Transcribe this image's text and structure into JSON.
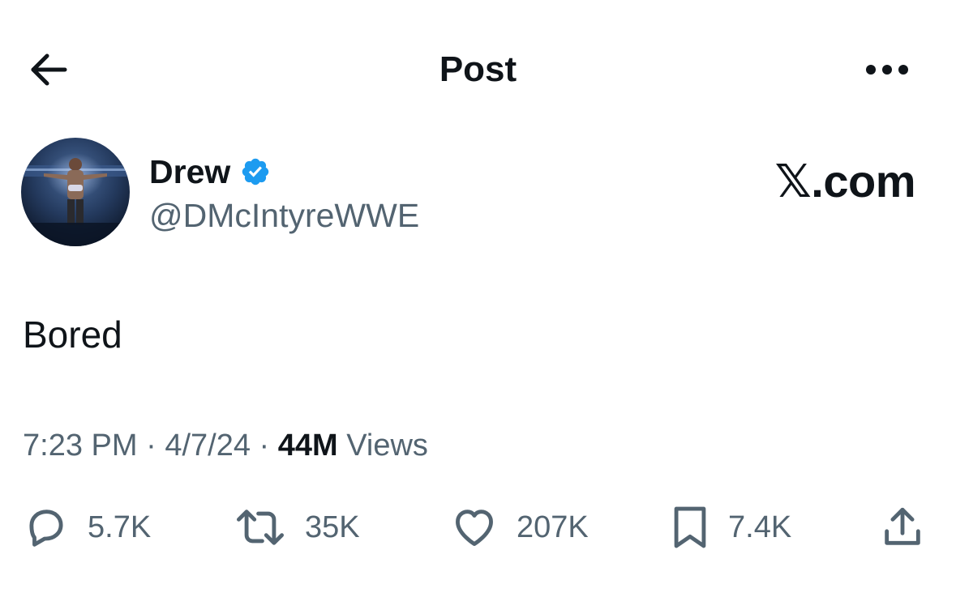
{
  "header": {
    "title": "Post",
    "back_icon": "arrow-left-icon",
    "more_icon": "more-horizontal-icon"
  },
  "author": {
    "display_name": "Drew",
    "handle": "@DMcIntyreWWE",
    "verified": true,
    "verified_color": "#1d9bf0"
  },
  "brand": "𝕏.com",
  "post": {
    "text": "Bored"
  },
  "meta": {
    "time": "7:23 PM",
    "separator": "·",
    "date": "4/7/24",
    "views_count": "44M",
    "views_label": "Views"
  },
  "actions": {
    "replies": "5.7K",
    "reposts": "35K",
    "likes": "207K",
    "bookmarks": "7.4K"
  },
  "colors": {
    "text_primary": "#0f1419",
    "text_secondary": "#536471",
    "background": "#ffffff"
  }
}
